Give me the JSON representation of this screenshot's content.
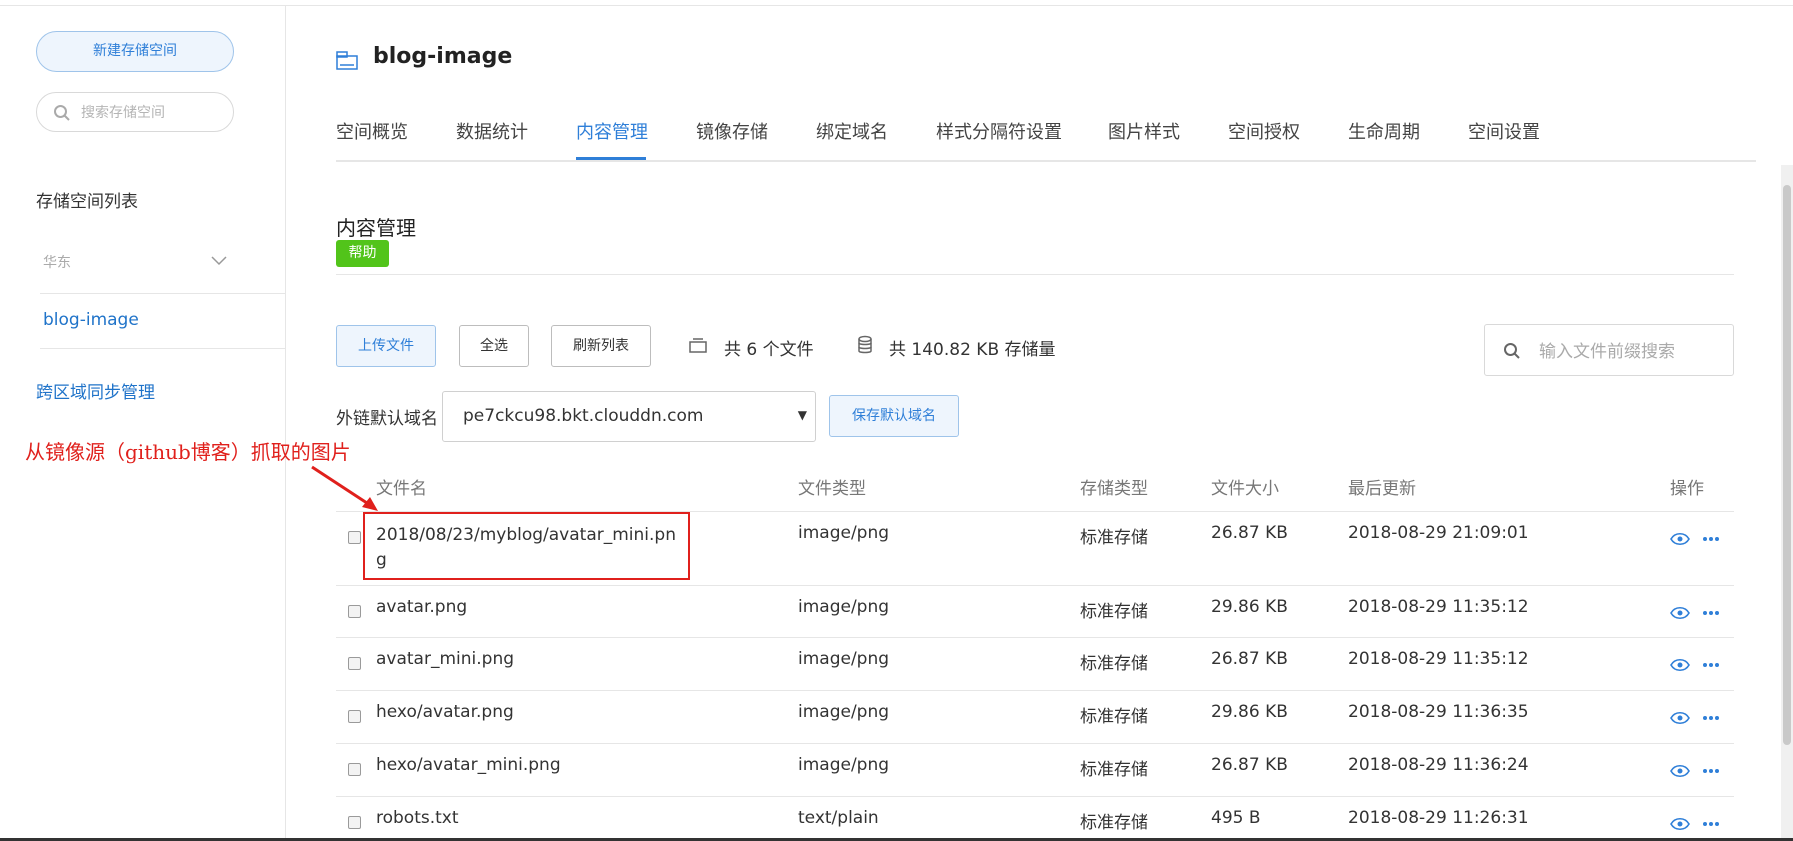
{
  "sidebar": {
    "new_bucket_label": "新建存储空间",
    "search_placeholder": "搜索存储空间",
    "list_title": "存储空间列表",
    "region": "华东",
    "bucket": "blog-image",
    "cross_region": "跨区域同步管理"
  },
  "header": {
    "bucket_title": "blog-image",
    "tabs": [
      {
        "label": "空间概览"
      },
      {
        "label": "数据统计"
      },
      {
        "label": "内容管理",
        "active": true
      },
      {
        "label": "镜像存储"
      },
      {
        "label": "绑定域名"
      },
      {
        "label": "样式分隔符设置"
      },
      {
        "label": "图片样式"
      },
      {
        "label": "空间授权"
      },
      {
        "label": "生命周期"
      },
      {
        "label": "空间设置"
      }
    ]
  },
  "content": {
    "section_title": "内容管理",
    "help": "帮助",
    "toolbar": {
      "upload": "上传文件",
      "select_all": "全选",
      "refresh": "刷新列表",
      "file_count": "共 6 个文件",
      "storage": "共 140.82 KB 存储量",
      "search_placeholder": "输入文件前缀搜索"
    },
    "domain": {
      "label": "外链默认域名",
      "value": "pe7ckcu98.bkt.clouddn.com",
      "save": "保存默认域名"
    },
    "annotation": "从镜像源（github博客）抓取的图片",
    "table": {
      "headers": {
        "name": "文件名",
        "type": "文件类型",
        "storage": "存储类型",
        "size": "文件大小",
        "updated": "最后更新",
        "actions": "操作"
      },
      "rows": [
        {
          "name": "2018/08/23/myblog/avatar_mini.png",
          "type": "image/png",
          "storage": "标准存储",
          "size": "26.87 KB",
          "updated": "2018-08-29 21:09:01"
        },
        {
          "name": "avatar.png",
          "type": "image/png",
          "storage": "标准存储",
          "size": "29.86 KB",
          "updated": "2018-08-29 11:35:12"
        },
        {
          "name": "avatar_mini.png",
          "type": "image/png",
          "storage": "标准存储",
          "size": "26.87 KB",
          "updated": "2018-08-29 11:35:12"
        },
        {
          "name": "hexo/avatar.png",
          "type": "image/png",
          "storage": "标准存储",
          "size": "29.86 KB",
          "updated": "2018-08-29 11:36:35"
        },
        {
          "name": "hexo/avatar_mini.png",
          "type": "image/png",
          "storage": "标准存储",
          "size": "26.87 KB",
          "updated": "2018-08-29 11:36:24"
        },
        {
          "name": "robots.txt",
          "type": "text/plain",
          "storage": "标准存储",
          "size": "495 B",
          "updated": "2018-08-29 11:26:31"
        }
      ]
    }
  },
  "colors": {
    "accent": "#2f7fd8",
    "help_green": "#52c41a",
    "annotation_red": "#e0201c"
  },
  "icons": [
    "search-icon",
    "chevron-down-icon",
    "bucket-icon",
    "files-icon",
    "database-icon",
    "eye-icon",
    "more-icon"
  ]
}
